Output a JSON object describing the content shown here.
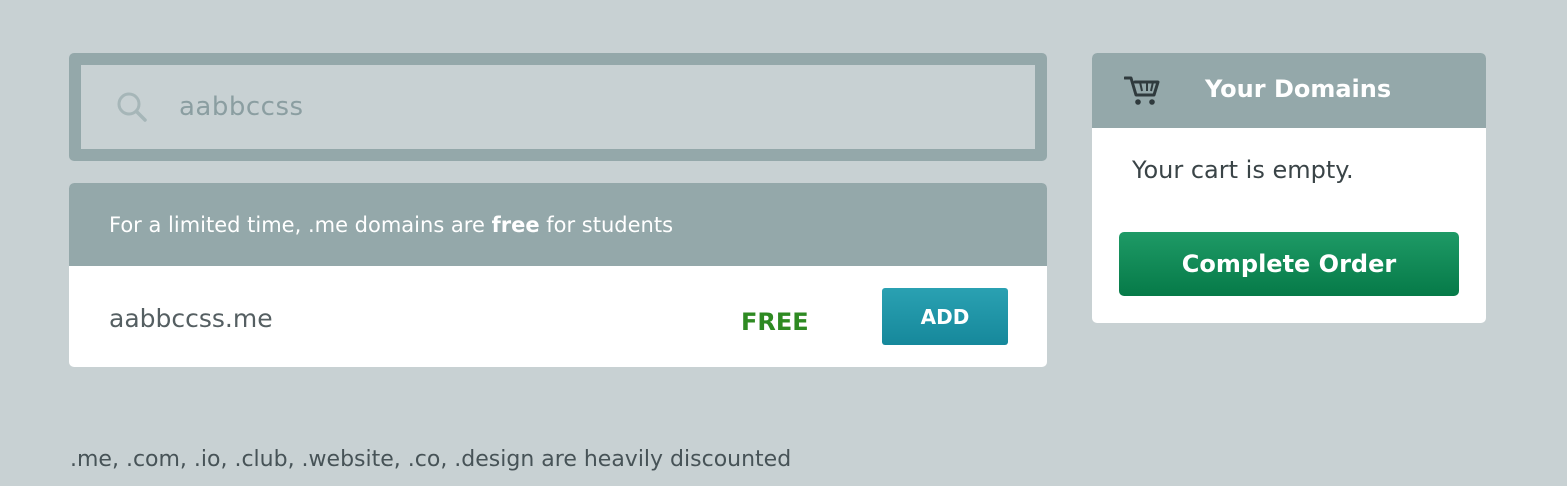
{
  "search": {
    "value": "aabbccss",
    "icon": "search-icon"
  },
  "promo": {
    "prefix": "For a limited time, .me domains are ",
    "bold": "free",
    "suffix": " for students"
  },
  "results": [
    {
      "domain": "aabbccss.me",
      "price": "FREE",
      "action": "ADD"
    }
  ],
  "cart": {
    "title": "Your Domains",
    "icon": "cart-icon",
    "empty_text": "Your cart is empty.",
    "button": "Complete Order"
  },
  "footnote": ".me, .com, .io, .club, .website, .co, .design are heavily discounted",
  "colors": {
    "background": "#c8d1d3",
    "panel_header": "#94a8aa",
    "price_green": "#2e8a22",
    "add_button": "#1e94a6",
    "complete_button": "#0f8a56"
  }
}
